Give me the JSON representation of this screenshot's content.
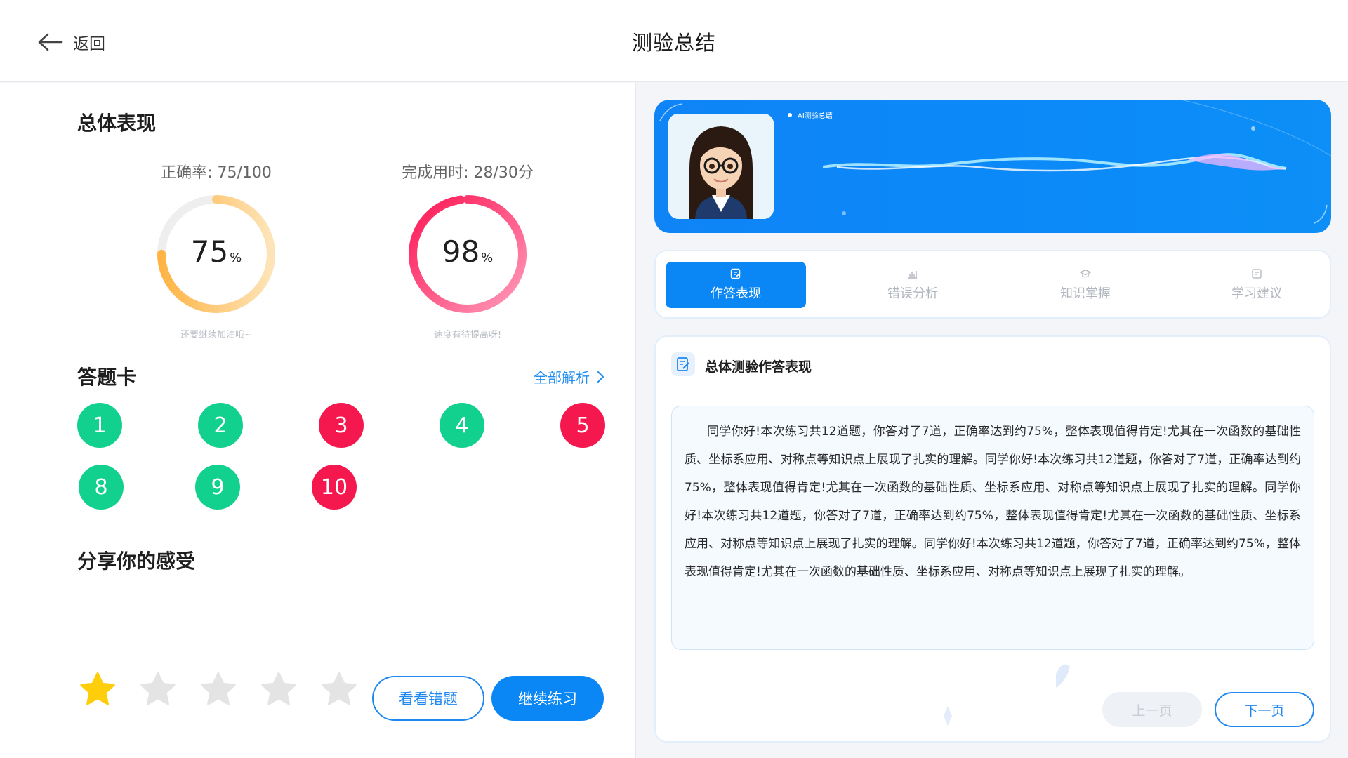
{
  "header": {
    "back_label": "返回",
    "title": "测验总结"
  },
  "overall": {
    "title": "总体表现",
    "accuracy": {
      "label": "正确率: 75/100",
      "value": "75",
      "unit": "%",
      "percent": 75,
      "hint": "还要继续加油哦~",
      "colors": [
        "#ffc76d",
        "#fde4b8"
      ]
    },
    "time": {
      "label": "完成用时: 28/30分",
      "value": "98",
      "unit": "%",
      "percent": 98,
      "hint": "速度有待提高呀!",
      "colors": [
        "#ff1654",
        "#ff9bbb"
      ]
    }
  },
  "answer_card": {
    "title": "答题卡",
    "all_analysis_label": "全部解析",
    "questions": [
      {
        "num": "1",
        "status": "correct"
      },
      {
        "num": "2",
        "status": "correct"
      },
      {
        "num": "3",
        "status": "wrong"
      },
      {
        "num": "4",
        "status": "correct"
      },
      {
        "num": "5",
        "status": "wrong"
      },
      {
        "num": "8",
        "status": "correct"
      },
      {
        "num": "9",
        "status": "correct"
      },
      {
        "num": "10",
        "status": "wrong"
      }
    ]
  },
  "feedback": {
    "title": "分享你的感受",
    "rating": 1,
    "max_rating": 5
  },
  "actions": {
    "review_wrong": "看看错题",
    "continue": "继续练习"
  },
  "banner": {
    "tag": "AI测验总结"
  },
  "tabs": [
    {
      "label": "作答表现",
      "icon": "edit-icon",
      "active": true
    },
    {
      "label": "错误分析",
      "icon": "chart-icon",
      "active": false
    },
    {
      "label": "知识掌握",
      "icon": "graduation-cap-icon",
      "active": false
    },
    {
      "label": "学习建议",
      "icon": "note-icon",
      "active": false
    }
  ],
  "content": {
    "title": "总体测验作答表现",
    "summary": "同学你好!本次练习共12道题，你答对了7道，正确率达到约75%，整体表现值得肯定!尤其在一次函数的基础性质、坐标系应用、对称点等知识点上展现了扎实的理解。同学你好!本次练习共12道题，你答对了7道，正确率达到约75%，整体表现值得肯定!尤其在一次函数的基础性质、坐标系应用、对称点等知识点上展现了扎实的理解。同学你好!本次练习共12道题，你答对了7道，正确率达到约75%，整体表现值得肯定!尤其在一次函数的基础性质、坐标系应用、对称点等知识点上展现了扎实的理解。同学你好!本次练习共12道题，你答对了7道，正确率达到约75%，整体表现值得肯定!尤其在一次函数的基础性质、坐标系应用、对称点等知识点上展现了扎实的理解。",
    "prev_label": "上一页",
    "next_label": "下一页"
  },
  "colors": {
    "accent": "#0a87f5",
    "correct": "#12d18e",
    "wrong": "#f5184f",
    "star_active": "#ffce0a",
    "star_inactive": "#e4e4e4"
  }
}
